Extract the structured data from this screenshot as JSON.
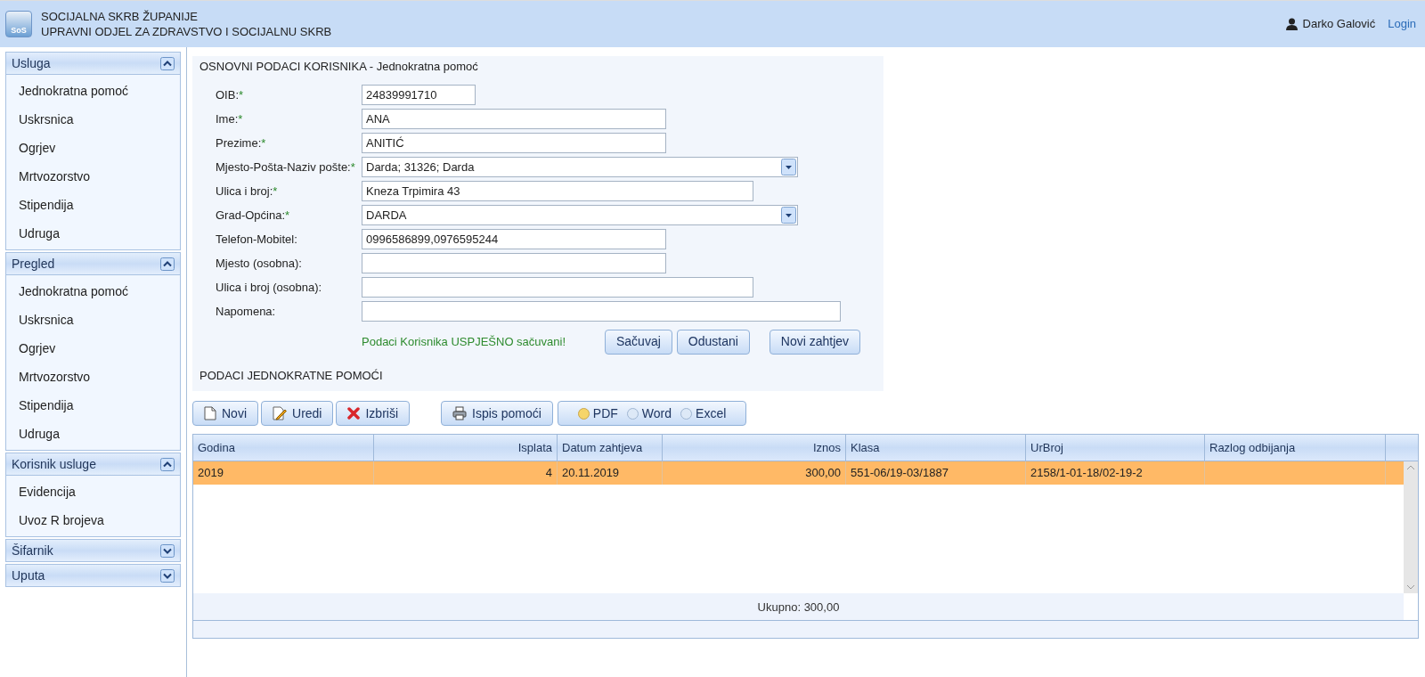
{
  "header": {
    "title_line_1": "SOCIJALNA SKRB ŽUPANIJE",
    "title_line_2": "UPRAVNI ODJEL ZA ZDRAVSTVO I SOCIJALNU SKRB",
    "logo_text": "SoS",
    "user": "Darko Galović",
    "login": "Login"
  },
  "sidebar": [
    {
      "title": "Usluga",
      "expanded": true,
      "items": [
        "Jednokratna pomoć",
        "Uskrsnica",
        "Ogrjev",
        "Mrtvozorstvo",
        "Stipendija",
        "Udruga"
      ]
    },
    {
      "title": "Pregled",
      "expanded": true,
      "items": [
        "Jednokratna pomoć",
        "Uskrsnica",
        "Ogrjev",
        "Mrtvozorstvo",
        "Stipendija",
        "Udruga"
      ]
    },
    {
      "title": "Korisnik usluge",
      "expanded": true,
      "items": [
        "Evidencija",
        "Uvoz R brojeva"
      ]
    },
    {
      "title": "Šifarnik",
      "expanded": false
    },
    {
      "title": "Uputa",
      "expanded": false
    }
  ],
  "form": {
    "title": "OSNOVNI PODACI KORISNIKA - Jednokratna pomoć",
    "fields": [
      {
        "label": "OIB:",
        "required": true,
        "kind": "text",
        "value": "24839991710"
      },
      {
        "label": "Ime:",
        "required": true,
        "kind": "text",
        "value": "ANA"
      },
      {
        "label": "Prezime:",
        "required": true,
        "kind": "text",
        "value": "ANITIĆ"
      },
      {
        "label": "Mjesto-Pošta-Naziv pošte:",
        "required": true,
        "kind": "select",
        "value": "Darda; 31326; Darda"
      },
      {
        "label": "Ulica i broj:",
        "required": true,
        "kind": "text",
        "value": "Kneza Trpimira 43"
      },
      {
        "label": "Grad-Općina:",
        "required": true,
        "kind": "select",
        "value": "DARDA"
      },
      {
        "label": "Telefon-Mobitel:",
        "required": false,
        "kind": "text",
        "value": "0996586899,0976595244"
      },
      {
        "label": "Mjesto (osobna):",
        "required": false,
        "kind": "text"
      },
      {
        "label": "Ulica i broj (osobna):",
        "required": false,
        "kind": "text"
      },
      {
        "label": "Napomena:",
        "required": false,
        "kind": "text"
      }
    ],
    "required_mark": "*",
    "status": "Podaci Korisnika USPJEŠNO sačuvani!",
    "buttons": [
      "Sačuvaj",
      "Odustani",
      "Novi zahtjev"
    ]
  },
  "section_title": "PODACI JEDNOKRATNE POMOĆI",
  "toolbar": [
    {
      "label": "Novi",
      "kind": "new"
    },
    {
      "label": "Uredi",
      "kind": "edit"
    },
    {
      "label": "Izbriši",
      "kind": "delete"
    },
    {
      "label": "Ispis pomoći",
      "kind": "print"
    }
  ],
  "formats": [
    {
      "label": "PDF",
      "selected": true
    },
    {
      "label": "Word",
      "selected": false
    },
    {
      "label": "Excel",
      "selected": false
    }
  ],
  "table": {
    "columns": [
      "Godina",
      "Isplata",
      "Datum zahtjeva",
      "Iznos",
      "Klasa",
      "UrBroj",
      "Razlog odbijanja"
    ],
    "rows": [
      {
        "selected": true,
        "cells": [
          "2019",
          "4",
          "20.11.2019",
          "300,00",
          "551-06/19-03/1887",
          "2158/1-01-18/02-19-2",
          ""
        ]
      }
    ],
    "total": "Ukupno: 300,00"
  }
}
